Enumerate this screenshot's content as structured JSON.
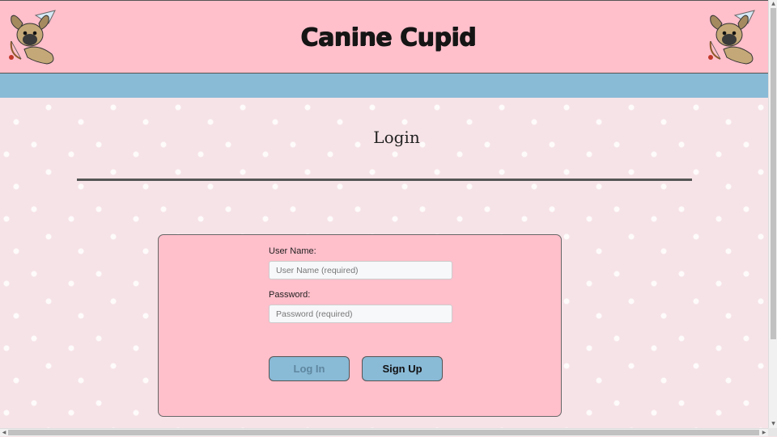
{
  "header": {
    "title": "Canine Cupid"
  },
  "logo": {
    "icon": "cupid-pug-icon"
  },
  "main": {
    "heading": "Login"
  },
  "login_form": {
    "username_label": "User Name:",
    "username_placeholder": "User Name (required)",
    "username_value": "",
    "password_label": "Password:",
    "password_placeholder": "Password (required)",
    "password_value": "",
    "login_button": "Log In",
    "signup_button": "Sign Up"
  },
  "colors": {
    "header_bg": "#ffbfcb",
    "nav_bg": "#89bad6",
    "content_bg": "#f6e3e7",
    "card_bg": "#ffbfcb",
    "button_bg": "#89bad6"
  }
}
